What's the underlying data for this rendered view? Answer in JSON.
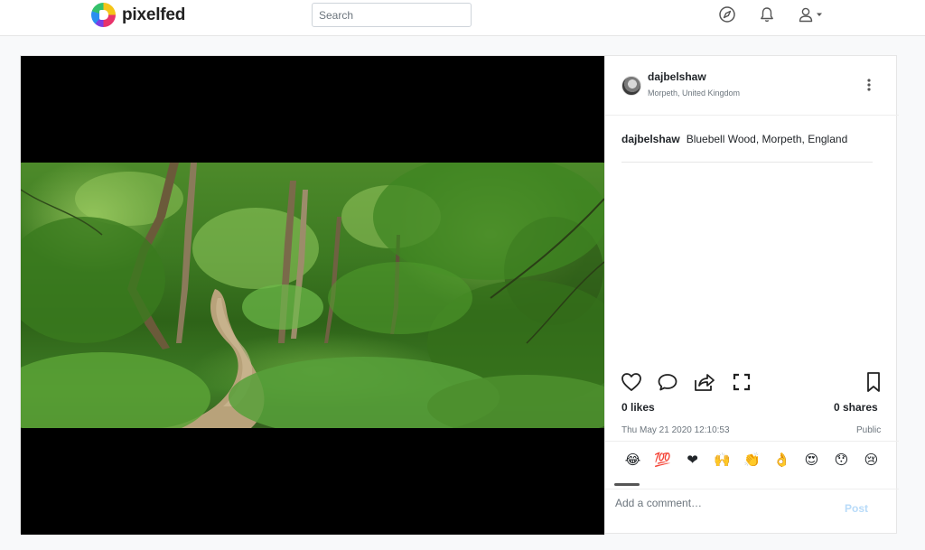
{
  "brand": {
    "name": "pixelfed"
  },
  "nav": {
    "search_placeholder": "Search"
  },
  "post": {
    "author": {
      "username": "dajbelshaw",
      "location": "Morpeth, United Kingdom"
    },
    "caption": {
      "username": "dajbelshaw",
      "text": "Bluebell Wood, Morpeth, England"
    },
    "likes": "0 likes",
    "shares": "0 shares",
    "timestamp": "Thu May 21 2020 12:10:53",
    "visibility": "Public",
    "emojis": [
      "😂",
      "💯",
      "❤",
      "🙌",
      "👏",
      "👌",
      "😍",
      "😯",
      "😢",
      "😅"
    ],
    "comment_placeholder": "Add a comment…",
    "post_label": "Post"
  },
  "colors": {
    "post_button_disabled": "#b8dbf9",
    "media_background": "#000000"
  }
}
